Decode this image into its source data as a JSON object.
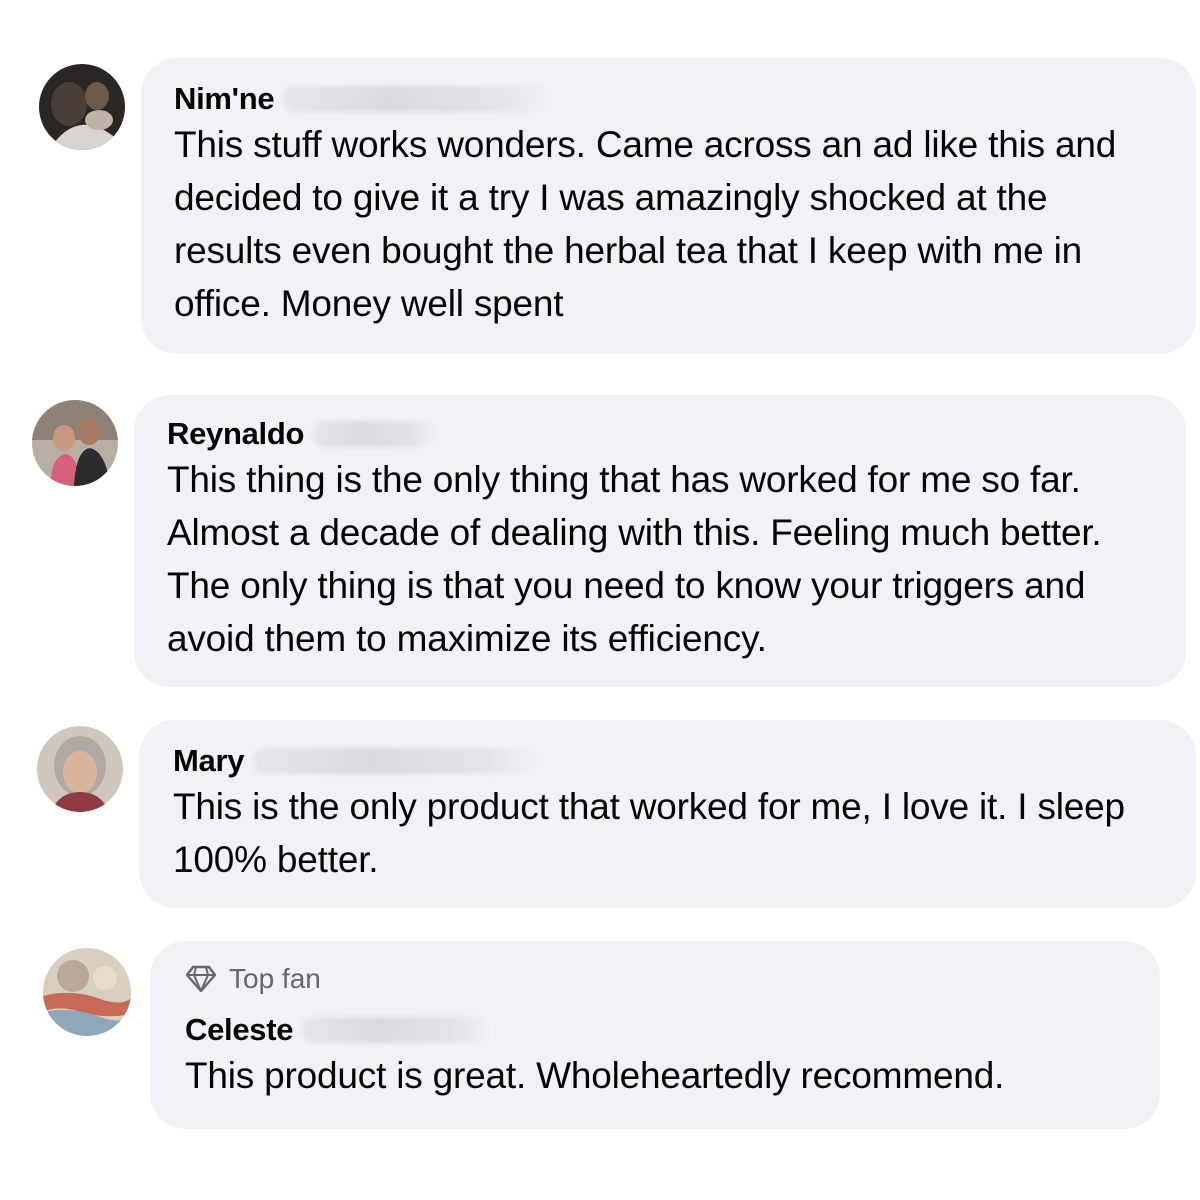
{
  "comments": [
    {
      "author": "Nim'ne",
      "text": "This stuff works wonders. Came across an ad like this and decided to give it a try I was amazingly shocked at the results even bought the herbal tea that I keep with me in office. Money well spent"
    },
    {
      "author": "Reynaldo",
      "text": "This thing is the only thing that has worked for me so far. Almost a decade of dealing with this. Feeling much better. The only thing is that you need to know your triggers and avoid them to maximize its efficiency."
    },
    {
      "author": "Mary",
      "text": "This is the only product that worked for me, I love it. I sleep 100% better."
    },
    {
      "badge": "Top fan",
      "author": "Celeste",
      "text": "This product is great. Wholeheartedly recommend."
    }
  ],
  "icons": {
    "badge_icon": "diamond-icon"
  },
  "colors": {
    "bubble": "#f0f2f5",
    "text": "#050505",
    "secondary_text": "#65676b"
  }
}
